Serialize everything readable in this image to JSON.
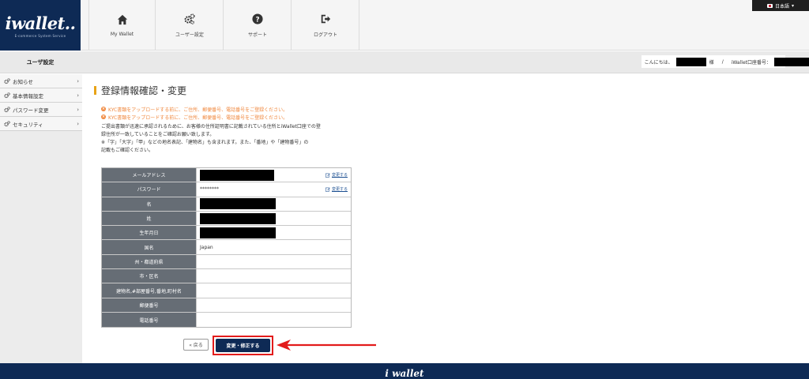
{
  "logo": {
    "brand": "wallet..",
    "tagline": "E-commerce System Service"
  },
  "language": {
    "label": "日本語"
  },
  "nav": {
    "items": [
      {
        "label": "My Wallet",
        "icon": "home-icon"
      },
      {
        "label": "ユーザー設定",
        "icon": "gears-icon"
      },
      {
        "label": "サポート",
        "icon": "question-icon"
      },
      {
        "label": "ログアウト",
        "icon": "logout-icon"
      }
    ]
  },
  "subbar": {
    "section_title": "ユーザ設定",
    "greeting_prefix": "こんにちは、",
    "greeting_suffix": "様",
    "separator": "/",
    "account_label": "iWallet口座番号："
  },
  "sidebar": {
    "items": [
      {
        "label": "お知らせ"
      },
      {
        "label": "基本情報設定"
      },
      {
        "label": "パスワード変更"
      },
      {
        "label": "セキュリティ"
      }
    ]
  },
  "page": {
    "title": "登録情報確認・変更",
    "notices": [
      "KYC書類をアップロードする前に、ご住所、郵便番号、電話番号をご登録ください。",
      "KYC書類をアップロードする前に、ご住所、郵便番号、電話番号をご登録ください。"
    ],
    "description": [
      "ご提出書類が迅速に承認されるために、お客様の住所証明書に記載されている住所とiWallet口座での登",
      "録住所が一致していることをご確認お願い致します。",
      "※「字」「大字」「甲」などの地名表記、「建物名」も含まれます。また、「番地」や「建物番号」の",
      "記載もご確認ください。"
    ]
  },
  "table": {
    "edit_label": "変更する",
    "rows": [
      {
        "label": "メールアドレス",
        "value": ""
      },
      {
        "label": "パスワード",
        "value": "********"
      },
      {
        "label": "名",
        "value": ""
      },
      {
        "label": "姓",
        "value": ""
      },
      {
        "label": "生年月日",
        "value": ""
      },
      {
        "label": "国名",
        "value": "Japan"
      },
      {
        "label": "州・都道府県",
        "value": ""
      },
      {
        "label": "市・区名",
        "value": ""
      },
      {
        "label": "建物名,#部屋番号,番地,町村名",
        "value": ""
      },
      {
        "label": "郵便番号",
        "value": ""
      },
      {
        "label": "電話番号",
        "value": ""
      }
    ]
  },
  "buttons": {
    "back": "« 戻る",
    "submit": "変更・修正する"
  },
  "footer": {
    "brand": "wallet"
  },
  "colors": {
    "brand_navy": "#0e2a55",
    "accent_orange": "#f0883e",
    "highlight_red": "#e21b1b",
    "table_label_bg": "#666d75"
  }
}
